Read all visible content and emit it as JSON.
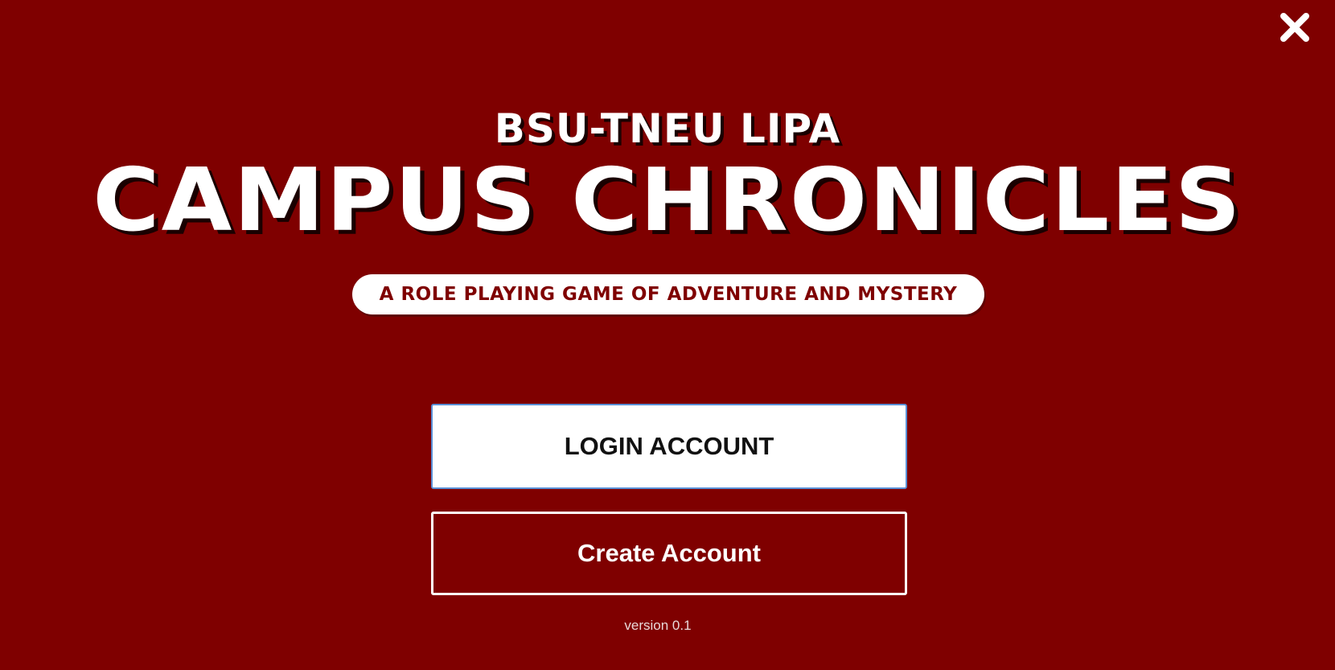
{
  "window": {
    "close_icon": "close-icon"
  },
  "header": {
    "subtitle": "BSU-TNEU LIPA",
    "title": "CAMPUS CHRONICLES",
    "tagline": "A ROLE PLAYING GAME OF ADVENTURE AND MYSTERY"
  },
  "actions": {
    "login_label": "LOGIN ACCOUNT",
    "create_label": "Create Account"
  },
  "footer": {
    "version": "version 0.1"
  },
  "colors": {
    "background": "#7f0000",
    "text": "#ffffff",
    "login_border": "#5a8fd6"
  }
}
